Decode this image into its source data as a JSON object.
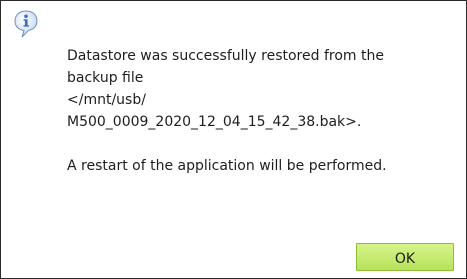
{
  "dialog": {
    "icon": "info-icon",
    "message_lines": [
      "Datastore was successfully restored from the",
      "backup file",
      "</mnt/usb/",
      "M500_0009_2020_12_04_15_42_38.bak>."
    ],
    "restart_note": "A restart of the application will be performed.",
    "ok_label": "OK"
  },
  "colors": {
    "ok_button": "#c6ec6e",
    "icon_blue": "#3a6fc4"
  }
}
